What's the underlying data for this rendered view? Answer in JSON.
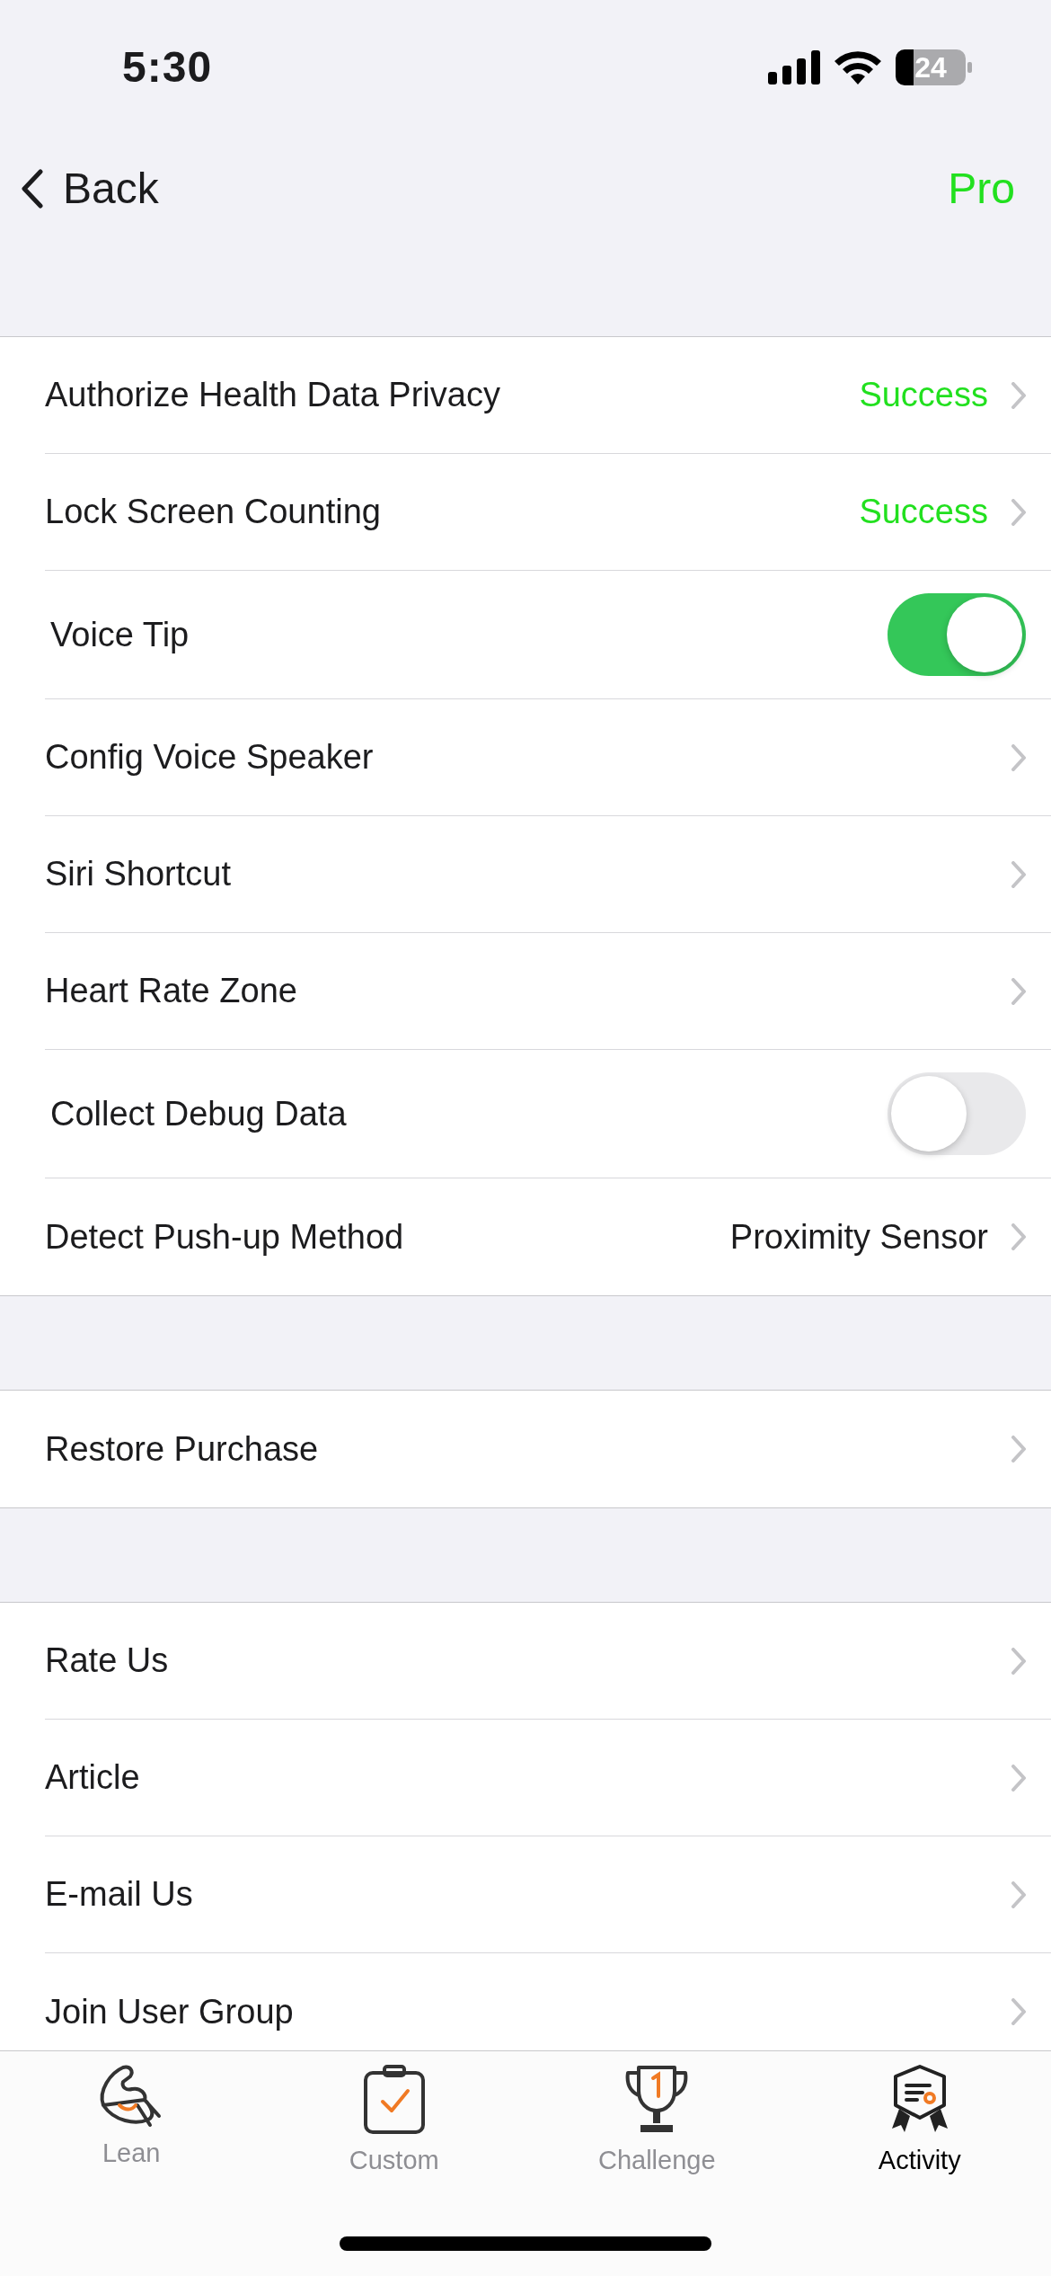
{
  "status_bar": {
    "time": "5:30",
    "battery": "24"
  },
  "nav": {
    "back": "Back",
    "action": "Pro"
  },
  "sections": [
    {
      "rows": [
        {
          "kind": "link",
          "label": "Authorize Health Data Privacy",
          "value": "Success",
          "color": "#22e01f"
        },
        {
          "kind": "link",
          "label": "Lock Screen Counting",
          "value": "Success",
          "color": "#22e01f"
        },
        {
          "kind": "toggle",
          "label": "Voice Tip",
          "on": true
        },
        {
          "kind": "link",
          "label": "Config Voice Speaker"
        },
        {
          "kind": "link",
          "label": "Siri Shortcut"
        },
        {
          "kind": "link",
          "label": "Heart Rate Zone"
        },
        {
          "kind": "toggle",
          "label": "Collect Debug Data",
          "on": false
        },
        {
          "kind": "link",
          "label": "Detect Push-up Method",
          "value": "Proximity Sensor",
          "color": "#1c1c1e"
        }
      ]
    },
    {
      "rows": [
        {
          "kind": "link",
          "label": "Restore Purchase"
        }
      ]
    },
    {
      "rows": [
        {
          "kind": "link",
          "label": "Rate Us"
        },
        {
          "kind": "link",
          "label": "Article"
        },
        {
          "kind": "link",
          "label": "E-mail Us"
        },
        {
          "kind": "link",
          "label": "Join User Group"
        }
      ]
    }
  ],
  "tabs": [
    {
      "label": "Lean",
      "selected": false
    },
    {
      "label": "Custom",
      "selected": false
    },
    {
      "label": "Challenge",
      "selected": false
    },
    {
      "label": "Activity",
      "selected": true
    }
  ]
}
